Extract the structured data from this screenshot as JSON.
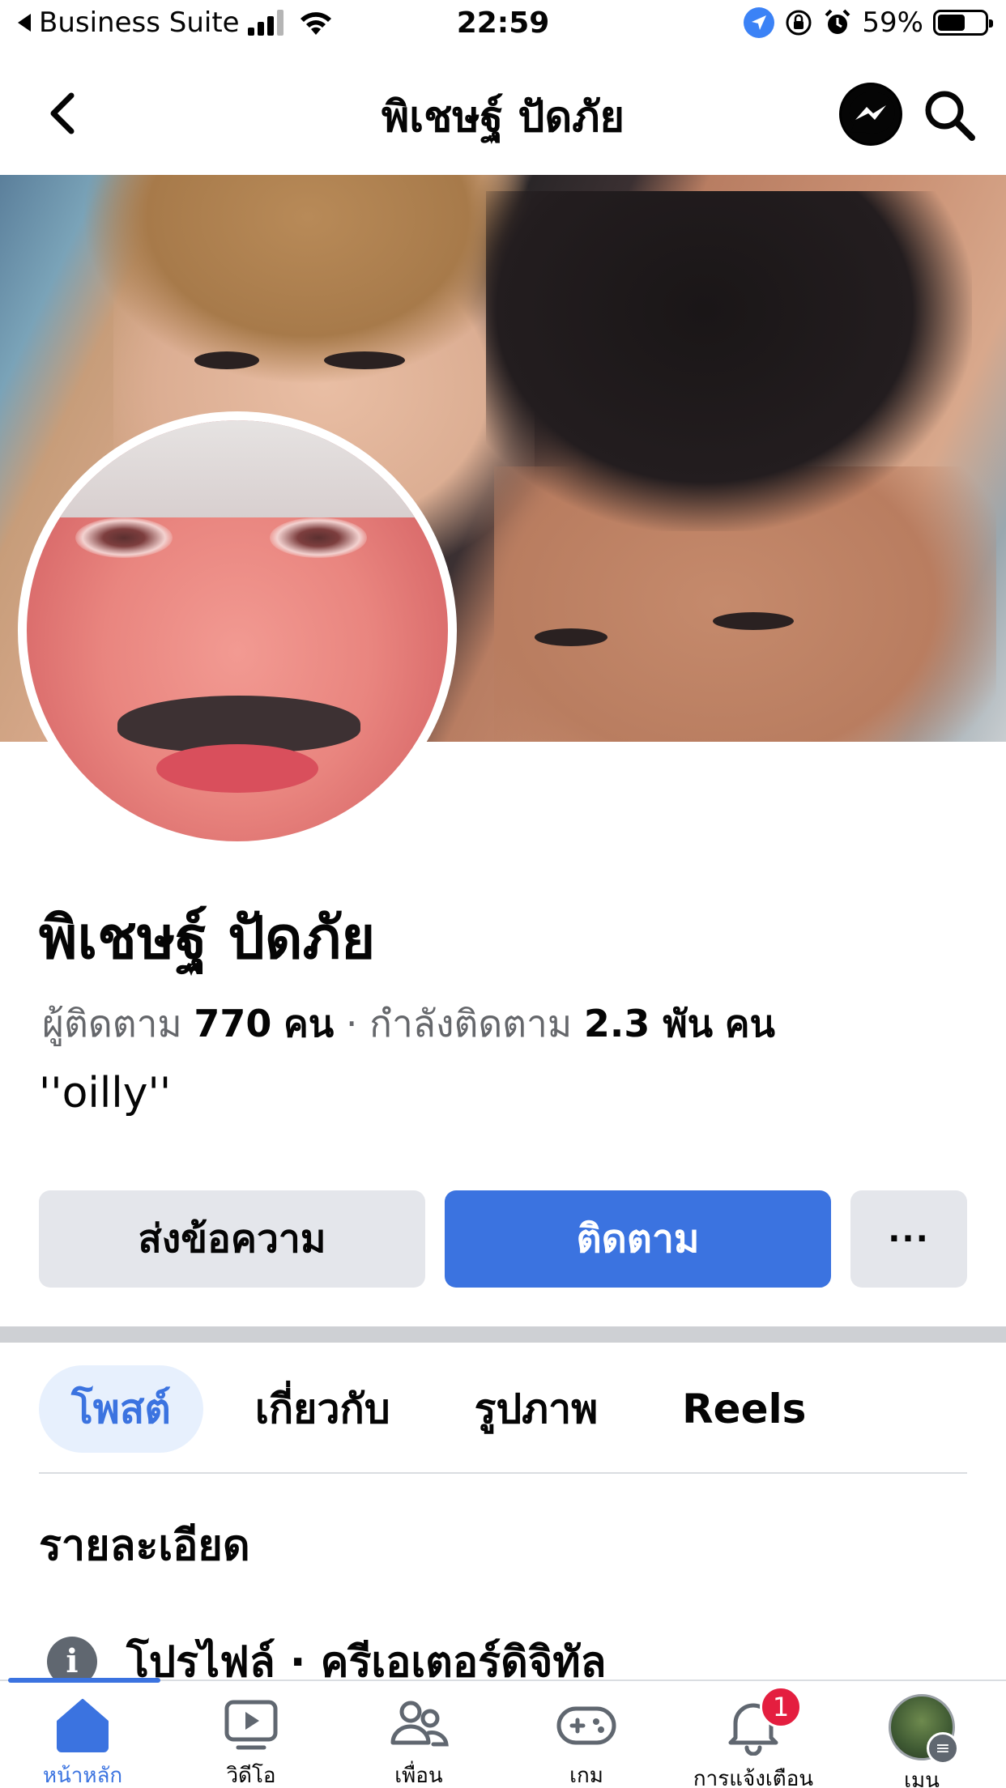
{
  "status_bar": {
    "back_app": "Business Suite",
    "time": "22:59",
    "battery_percent": "59%",
    "battery_level": 0.59
  },
  "nav": {
    "title": "พิเชษฐ์ ปัดภัย"
  },
  "profile": {
    "name": "พิเชษฐ์ ปัดภัย",
    "followers_label": "ผู้ติดตาม",
    "followers_count": "770",
    "followers_unit": "คน",
    "separator": "·",
    "following_label": "กำลังติดตาม",
    "following_count": "2.3 พัน",
    "following_unit": "คน",
    "bio": "''oilly''"
  },
  "actions": {
    "message_label": "ส่งข้อความ",
    "follow_label": "ติดตาม",
    "more_label": "···"
  },
  "tabs": [
    {
      "label": "โพสต์",
      "active": true
    },
    {
      "label": "เกี่ยวกับ",
      "active": false
    },
    {
      "label": "รูปภาพ",
      "active": false
    },
    {
      "label": "Reels",
      "active": false
    }
  ],
  "details": {
    "title": "รายละเอียด",
    "profile_type": "โปรไฟล์ · ครีเอเตอร์ดิจิทัล"
  },
  "bottom_nav": {
    "items": [
      {
        "label": "หน้าหลัก",
        "icon": "home-icon",
        "active": true
      },
      {
        "label": "วิดีโอ",
        "icon": "video-icon",
        "active": false
      },
      {
        "label": "เพื่อน",
        "icon": "friends-icon",
        "active": false
      },
      {
        "label": "เกม",
        "icon": "gaming-icon",
        "active": false
      },
      {
        "label": "การแจ้งเตือน",
        "icon": "bell-icon",
        "active": false,
        "badge": "1"
      },
      {
        "label": "เมนู",
        "icon": "menu-avatar",
        "active": false
      }
    ]
  },
  "colors": {
    "accent": "#3b73e0",
    "badge": "#e41e3f",
    "button_gray": "#e4e6eb"
  }
}
